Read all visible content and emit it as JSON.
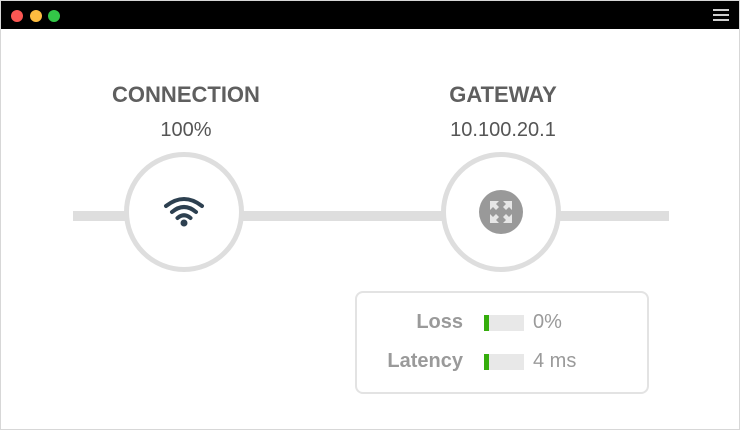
{
  "window": {
    "controls": [
      "close",
      "minimize",
      "zoom"
    ],
    "menu_icon": "hamburger-menu-icon"
  },
  "connection": {
    "title": "CONNECTION",
    "value": "100%",
    "icon": "wifi-icon"
  },
  "gateway": {
    "title": "GATEWAY",
    "value": "10.100.20.1",
    "icon": "collapse-arrows-icon"
  },
  "stats": {
    "loss": {
      "label": "Loss",
      "value": "0%",
      "level": 0.12
    },
    "latency": {
      "label": "Latency",
      "value": "4 ms",
      "level": 0.12
    }
  },
  "colors": {
    "titlebar": "#000000",
    "track": "#dedede",
    "bar_fill": "#35ad0c",
    "wifi": "#2d4050",
    "gateway_badge": "#999999"
  }
}
